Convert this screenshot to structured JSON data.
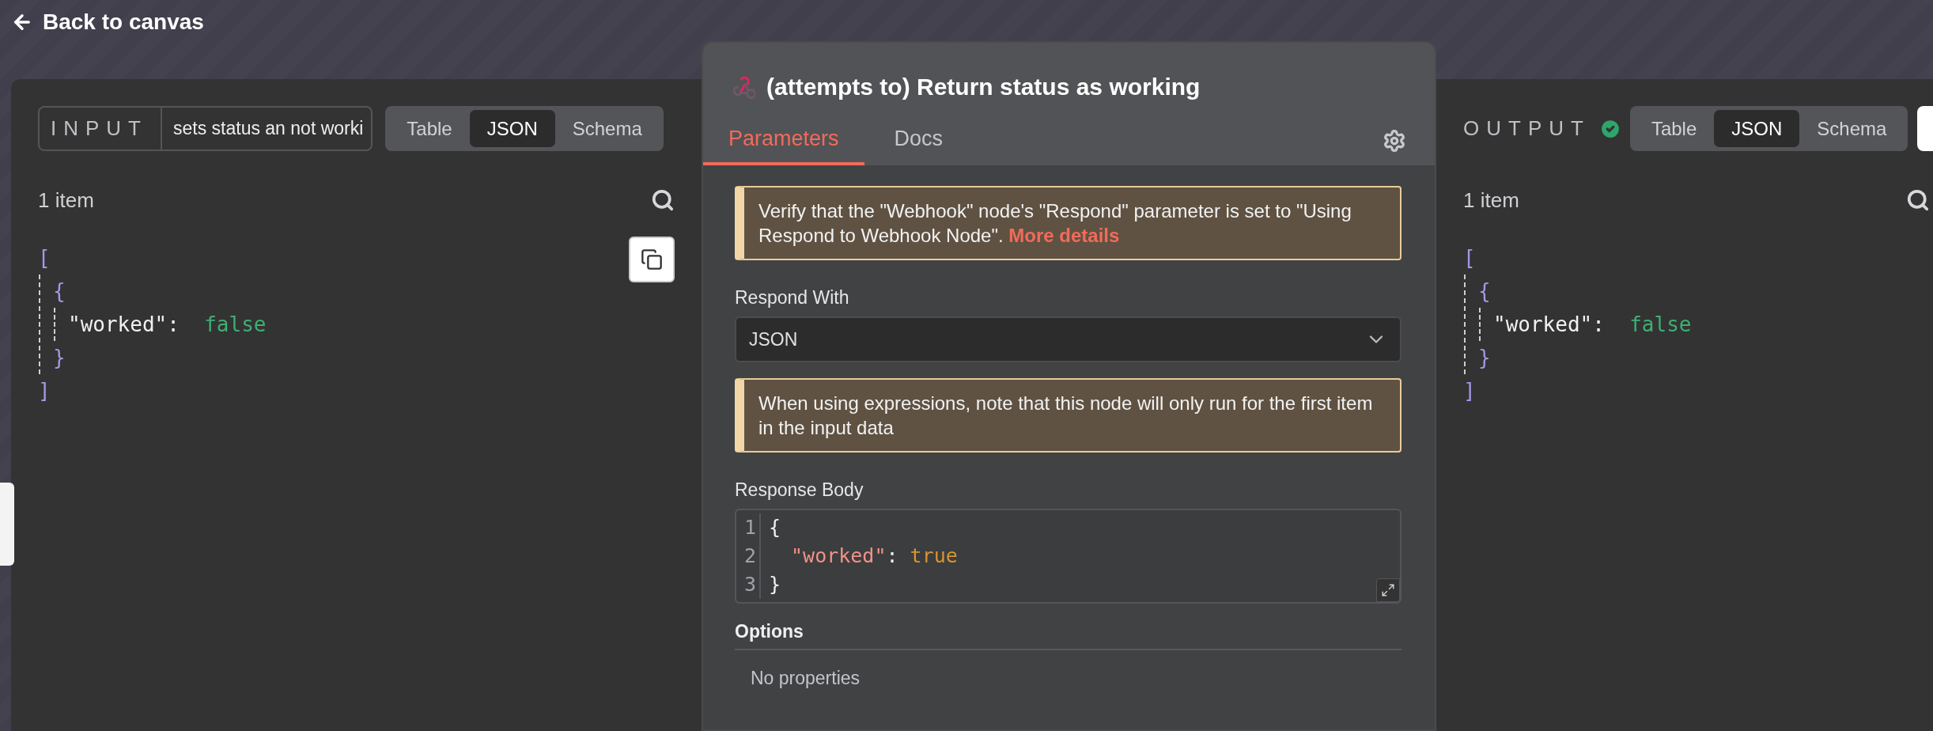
{
  "nav": {
    "back_label": "Back to canvas"
  },
  "input_panel": {
    "title": "INPUT",
    "node_select": "sets status an not worki",
    "view_tabs": [
      {
        "label": "Table",
        "selected": false
      },
      {
        "label": "JSON",
        "selected": true
      },
      {
        "label": "Schema",
        "selected": false
      }
    ],
    "item_count": "1 item",
    "json_tree": {
      "open": "[",
      "close": "]",
      "children": [
        {
          "open": "{",
          "close": "}",
          "children": [
            {
              "key": "\"worked\":",
              "value": "false"
            }
          ]
        }
      ]
    }
  },
  "node_panel": {
    "title": "(attempts to) Return status as working",
    "tabs": [
      {
        "label": "Parameters",
        "selected": true
      },
      {
        "label": "Docs",
        "selected": false
      }
    ],
    "notices": [
      {
        "text": "Verify that the \"Webhook\" node's \"Respond\" parameter is set to \"Using Respond to Webhook Node\".",
        "link": "More details"
      },
      {
        "text": "When using expressions, note that this node will only run for the first item in the input data"
      }
    ],
    "respond_with": {
      "label": "Respond With",
      "value": "JSON"
    },
    "response_body": {
      "label": "Response Body",
      "lines": [
        {
          "number": "1",
          "indented": false,
          "parts": [
            {
              "kind": "punct",
              "text": "{"
            }
          ]
        },
        {
          "number": "2",
          "indented": true,
          "parts": [
            {
              "kind": "key",
              "text": "\"worked\""
            },
            {
              "kind": "punct",
              "text": ": "
            },
            {
              "kind": "bool",
              "text": "true"
            }
          ]
        },
        {
          "number": "3",
          "indented": false,
          "parts": [
            {
              "kind": "punct",
              "text": "}"
            }
          ]
        }
      ]
    },
    "options": {
      "title": "Options",
      "empty_text": "No properties"
    }
  },
  "output_panel": {
    "title": "OUTPUT",
    "success": true,
    "view_tabs": [
      {
        "label": "Table",
        "selected": false
      },
      {
        "label": "JSON",
        "selected": true
      },
      {
        "label": "Schema",
        "selected": false
      }
    ],
    "item_count": "1 item",
    "json_tree": {
      "open": "[",
      "close": "]",
      "children": [
        {
          "open": "{",
          "close": "}",
          "children": [
            {
              "key": "\"worked\":",
              "value": "false"
            }
          ]
        }
      ]
    }
  }
}
